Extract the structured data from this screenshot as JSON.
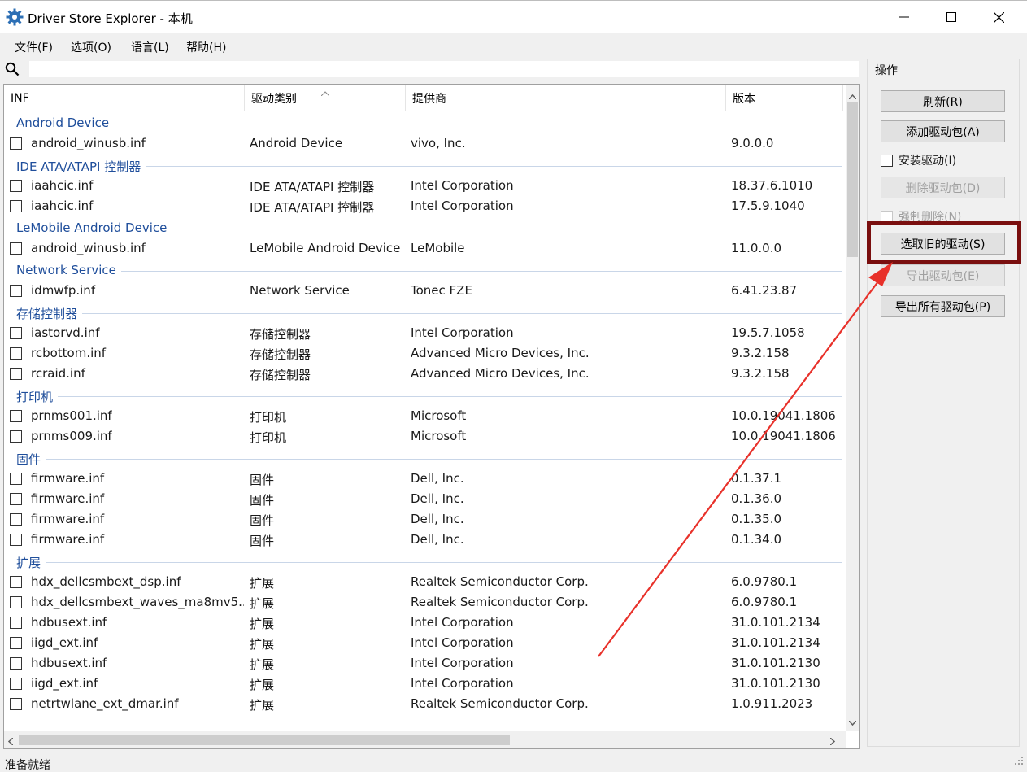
{
  "window": {
    "title": "Driver Store Explorer - 本机",
    "minimize_glyph": "—",
    "maximize_glyph": "☐",
    "close_glyph": "✕"
  },
  "menu": {
    "items": [
      {
        "label": "文件(F)"
      },
      {
        "label": "选项(O)"
      },
      {
        "label": "语言(L)"
      },
      {
        "label": "帮助(H)"
      }
    ]
  },
  "search": {
    "icon": "search-icon",
    "value": "",
    "placeholder": ""
  },
  "table": {
    "columns": [
      "INF",
      "驱动类别",
      "提供商",
      "版本"
    ],
    "sorted_column": "驱动类别",
    "groups": [
      {
        "title": "Android Device",
        "rows": [
          {
            "inf": "android_winusb.inf",
            "category": "Android Device",
            "provider": "vivo, Inc.",
            "version": "9.0.0.0"
          }
        ]
      },
      {
        "title": "IDE ATA/ATAPI 控制器",
        "rows": [
          {
            "inf": "iaahcic.inf",
            "category": "IDE ATA/ATAPI 控制器",
            "provider": "Intel Corporation",
            "version": "18.37.6.1010"
          },
          {
            "inf": "iaahcic.inf",
            "category": "IDE ATA/ATAPI 控制器",
            "provider": "Intel Corporation",
            "version": "17.5.9.1040"
          }
        ]
      },
      {
        "title": "LeMobile Android Device",
        "rows": [
          {
            "inf": "android_winusb.inf",
            "category": "LeMobile Android Device",
            "provider": "LeMobile",
            "version": "11.0.0.0"
          }
        ]
      },
      {
        "title": "Network Service",
        "rows": [
          {
            "inf": "idmwfp.inf",
            "category": "Network Service",
            "provider": "Tonec FZE",
            "version": "6.41.23.87"
          }
        ]
      },
      {
        "title": "存储控制器",
        "rows": [
          {
            "inf": "iastorvd.inf",
            "category": "存储控制器",
            "provider": "Intel Corporation",
            "version": "19.5.7.1058"
          },
          {
            "inf": "rcbottom.inf",
            "category": "存储控制器",
            "provider": "Advanced Micro Devices, Inc.",
            "version": "9.3.2.158"
          },
          {
            "inf": "rcraid.inf",
            "category": "存储控制器",
            "provider": "Advanced Micro Devices, Inc.",
            "version": "9.3.2.158"
          }
        ]
      },
      {
        "title": "打印机",
        "rows": [
          {
            "inf": "prnms001.inf",
            "category": "打印机",
            "provider": "Microsoft",
            "version": "10.0.19041.1806"
          },
          {
            "inf": "prnms009.inf",
            "category": "打印机",
            "provider": "Microsoft",
            "version": "10.0.19041.1806"
          }
        ]
      },
      {
        "title": "固件",
        "rows": [
          {
            "inf": "firmware.inf",
            "category": "固件",
            "provider": "Dell, Inc.",
            "version": "0.1.37.1"
          },
          {
            "inf": "firmware.inf",
            "category": "固件",
            "provider": "Dell, Inc.",
            "version": "0.1.36.0"
          },
          {
            "inf": "firmware.inf",
            "category": "固件",
            "provider": "Dell, Inc.",
            "version": "0.1.35.0"
          },
          {
            "inf": "firmware.inf",
            "category": "固件",
            "provider": "Dell, Inc.",
            "version": "0.1.34.0"
          }
        ]
      },
      {
        "title": "扩展",
        "rows": [
          {
            "inf": "hdx_dellcsmbext_dsp.inf",
            "category": "扩展",
            "provider": "Realtek Semiconductor Corp.",
            "version": "6.0.9780.1"
          },
          {
            "inf": "hdx_dellcsmbext_waves_ma8mv5...",
            "category": "扩展",
            "provider": "Realtek Semiconductor Corp.",
            "version": "6.0.9780.1"
          },
          {
            "inf": "hdbusext.inf",
            "category": "扩展",
            "provider": "Intel Corporation",
            "version": "31.0.101.2134"
          },
          {
            "inf": "iigd_ext.inf",
            "category": "扩展",
            "provider": "Intel Corporation",
            "version": "31.0.101.2134"
          },
          {
            "inf": "hdbusext.inf",
            "category": "扩展",
            "provider": "Intel Corporation",
            "version": "31.0.101.2130"
          },
          {
            "inf": "iigd_ext.inf",
            "category": "扩展",
            "provider": "Intel Corporation",
            "version": "31.0.101.2130"
          },
          {
            "inf": "netrtwlane_ext_dmar.inf",
            "category": "扩展",
            "provider": "Realtek Semiconductor Corp.",
            "version": "1.0.911.2023"
          }
        ]
      }
    ]
  },
  "operations": {
    "title": "操作",
    "refresh": "刷新(R)",
    "add_driver": "添加驱动包(A)",
    "install_driver": "安装驱动(I)",
    "delete_driver": "删除驱动包(D)",
    "force_delete": "强制删除(N)",
    "select_old": "选取旧的驱动(S)",
    "export_driver": "导出驱动包(E)",
    "export_all": "导出所有驱动包(P)"
  },
  "status": {
    "text": "准备就绪"
  },
  "colors": {
    "group_title": "#1f4e9b",
    "highlight_box": "#7a0f0f",
    "annotation_arrow": "#e8312a"
  }
}
